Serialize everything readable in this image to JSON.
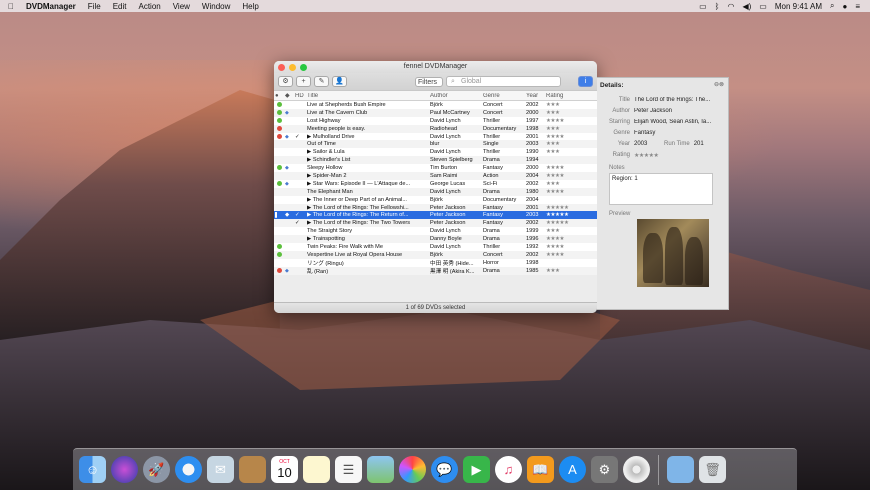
{
  "menubar": {
    "apple": "",
    "app": "DVDManager",
    "items": [
      "File",
      "Edit",
      "Action",
      "View",
      "Window",
      "Help"
    ],
    "clock": "Mon 9:41 AM"
  },
  "window": {
    "title": "fennel DVDManager",
    "filters_label": "Filters",
    "search_placeholder": "Global",
    "columns": [
      "HD",
      "Title",
      "Author",
      "Genre",
      "Year",
      "Rating"
    ],
    "status": "1 of 69 DVDs selected",
    "rows": [
      {
        "dot": "g",
        "hd": "",
        "chk": "",
        "tri": "",
        "title": "Live at Shepherds Bush Empire",
        "author": "Björk",
        "genre": "Concert",
        "year": "2002",
        "rating": "★★★"
      },
      {
        "dot": "g",
        "hd": "b",
        "chk": "",
        "tri": "",
        "title": "Live at The Cavern Club",
        "author": "Paul McCartney",
        "genre": "Concert",
        "year": "2000",
        "rating": "★★★"
      },
      {
        "dot": "g",
        "hd": "",
        "chk": "",
        "tri": "",
        "title": "Lost Highway",
        "author": "David Lynch",
        "genre": "Thriller",
        "year": "1997",
        "rating": "★★★★"
      },
      {
        "dot": "r",
        "hd": "",
        "chk": "",
        "tri": "",
        "title": "Meeting people is easy.",
        "author": "Radiohead",
        "genre": "Documentary",
        "year": "1998",
        "rating": "★★★"
      },
      {
        "dot": "r",
        "hd": "b",
        "chk": "✓",
        "tri": "▶",
        "title": "Mulholland Drive",
        "author": "David Lynch",
        "genre": "Thriller",
        "year": "2001",
        "rating": "★★★★"
      },
      {
        "dot": "",
        "hd": "",
        "chk": "",
        "tri": "",
        "title": "Out of Time",
        "author": "blur",
        "genre": "Single",
        "year": "2003",
        "rating": "★★★"
      },
      {
        "dot": "",
        "hd": "",
        "chk": "",
        "tri": "▶",
        "title": "Sailor & Lula",
        "author": "David Lynch",
        "genre": "Thriller",
        "year": "1990",
        "rating": "★★★"
      },
      {
        "dot": "",
        "hd": "",
        "chk": "",
        "tri": "▶",
        "title": "Schindler's List",
        "author": "Steven Spielberg",
        "genre": "Drama",
        "year": "1994",
        "rating": ""
      },
      {
        "dot": "g",
        "hd": "b",
        "chk": "",
        "tri": "",
        "title": "Sleepy Hollow",
        "author": "Tim Burton",
        "genre": "Fantasy",
        "year": "2000",
        "rating": "★★★★"
      },
      {
        "dot": "",
        "hd": "",
        "chk": "",
        "tri": "▶",
        "title": "Spider-Man 2",
        "author": "Sam Raimi",
        "genre": "Action",
        "year": "2004",
        "rating": "★★★★"
      },
      {
        "dot": "g",
        "hd": "b",
        "chk": "",
        "tri": "▶",
        "title": "Star Wars: Episode II — L'Attaque de...",
        "author": "George Lucas",
        "genre": "Sci-Fi",
        "year": "2002",
        "rating": "★★★"
      },
      {
        "dot": "",
        "hd": "",
        "chk": "",
        "tri": "",
        "title": "The Elephant Man",
        "author": "David Lynch",
        "genre": "Drama",
        "year": "1980",
        "rating": "★★★★"
      },
      {
        "dot": "",
        "hd": "",
        "chk": "",
        "tri": "▶",
        "title": "The Inner or Deep Part of an Animal...",
        "author": "Björk",
        "genre": "Documentary",
        "year": "2004",
        "rating": ""
      },
      {
        "dot": "",
        "hd": "",
        "chk": "",
        "tri": "▶",
        "title": "The Lord of the Rings: The Fellowshi...",
        "author": "Peter Jackson",
        "genre": "Fantasy",
        "year": "2001",
        "rating": "★★★★★"
      },
      {
        "dot": "b",
        "hd": "w",
        "chk": "✓",
        "tri": "▶",
        "title": "The Lord of the Rings: The Return of...",
        "author": "Peter Jackson",
        "genre": "Fantasy",
        "year": "2003",
        "rating": "★★★★★",
        "selected": true
      },
      {
        "dot": "",
        "hd": "",
        "chk": "✓",
        "tri": "▶",
        "title": "The Lord of the Rings: The Two Towers",
        "author": "Peter Jackson",
        "genre": "Fantasy",
        "year": "2002",
        "rating": "★★★★★"
      },
      {
        "dot": "",
        "hd": "",
        "chk": "",
        "tri": "",
        "title": "The Straight Story",
        "author": "David Lynch",
        "genre": "Drama",
        "year": "1999",
        "rating": "★★★"
      },
      {
        "dot": "",
        "hd": "",
        "chk": "",
        "tri": "▶",
        "title": "Trainspotting",
        "author": "Danny Boyle",
        "genre": "Drama",
        "year": "1996",
        "rating": "★★★★"
      },
      {
        "dot": "g",
        "hd": "",
        "chk": "",
        "tri": "",
        "title": "Twin Peaks: Fire Walk with Me",
        "author": "David Lynch",
        "genre": "Thriller",
        "year": "1992",
        "rating": "★★★★"
      },
      {
        "dot": "g",
        "hd": "",
        "chk": "",
        "tri": "",
        "title": "Vespertine Live at Royal Opera House",
        "author": "Björk",
        "genre": "Concert",
        "year": "2002",
        "rating": "★★★★"
      },
      {
        "dot": "",
        "hd": "",
        "chk": "",
        "tri": "",
        "title": "リング (Ringu)",
        "author": "中田 英秀 (Hide...",
        "genre": "Horror",
        "year": "1998",
        "rating": ""
      },
      {
        "dot": "r",
        "hd": "b",
        "chk": "",
        "tri": "",
        "title": "乱 (Ran)",
        "author": "黒澤 明 (Akira K...",
        "genre": "Drama",
        "year": "1985",
        "rating": "★★★"
      }
    ]
  },
  "details": {
    "header": "Details:",
    "labels": {
      "title": "Title",
      "author": "Author",
      "starring": "Starring",
      "genre": "Genre",
      "year": "Year",
      "runtime": "Run Time",
      "rating": "Rating",
      "notes": "Notes",
      "preview": "Preview"
    },
    "title": "The Lord of the Rings: The...",
    "author": "Peter Jackson",
    "starring": "Elijah Wood, Sean Astin, Ia...",
    "genre": "Fantasy",
    "year": "2003",
    "runtime": "201",
    "rating": "★★★★★",
    "notes": "Region: 1"
  },
  "dock": {
    "icons": [
      "finder-icon",
      "siri-icon",
      "launchpad-icon",
      "safari-icon",
      "mail-icon",
      "notes-app-icon",
      "calendar-icon",
      "textedit-icon",
      "reminders-icon",
      "maps-icon",
      "photos-icon",
      "messages-icon",
      "facetime-icon",
      "itunes-icon",
      "ibooks-icon",
      "appstore-icon",
      "preferences-icon",
      "dvdmanager-icon",
      "downloads-icon",
      "trash-icon"
    ],
    "calendar_month": "OCT",
    "calendar_day": "10"
  }
}
